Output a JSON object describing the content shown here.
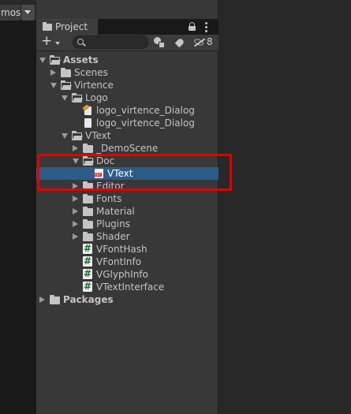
{
  "gizmos": {
    "label": "mos"
  },
  "project_panel": {
    "tab_label": "Project",
    "hidden_count": "8"
  },
  "tree": [
    {
      "label": "Assets",
      "bold": true,
      "depth": 0,
      "expand": "open",
      "icon": "folder-open-icon"
    },
    {
      "label": "Scenes",
      "depth": 1,
      "expand": "closed",
      "icon": "folder-icon"
    },
    {
      "label": "Virtence",
      "depth": 1,
      "expand": "open",
      "icon": "folder-open-icon"
    },
    {
      "label": "Logo",
      "depth": 2,
      "expand": "open",
      "icon": "folder-open-icon"
    },
    {
      "label": "logo_virtence_Dialog",
      "depth": 3,
      "expand": "none",
      "icon": "image-asset-icon"
    },
    {
      "label": "logo_virtence_Dialog",
      "depth": 3,
      "expand": "none",
      "icon": "file-icon"
    },
    {
      "label": "VText",
      "depth": 2,
      "expand": "open",
      "icon": "folder-open-icon"
    },
    {
      "label": "_DemoScene",
      "depth": 3,
      "expand": "closed",
      "icon": "folder-icon"
    },
    {
      "label": "Doc",
      "depth": 3,
      "expand": "open",
      "icon": "folder-open-icon"
    },
    {
      "label": "VText",
      "depth": 4,
      "expand": "none",
      "icon": "pdf-icon",
      "selected": true
    },
    {
      "label": "Editor",
      "depth": 3,
      "expand": "closed",
      "icon": "folder-icon"
    },
    {
      "label": "Fonts",
      "depth": 3,
      "expand": "closed",
      "icon": "folder-icon"
    },
    {
      "label": "Material",
      "depth": 3,
      "expand": "closed",
      "icon": "folder-icon"
    },
    {
      "label": "Plugins",
      "depth": 3,
      "expand": "closed",
      "icon": "folder-icon"
    },
    {
      "label": "Shader",
      "depth": 3,
      "expand": "closed",
      "icon": "folder-icon"
    },
    {
      "label": "VFontHash",
      "depth": 3,
      "expand": "none",
      "icon": "csharp-script-icon"
    },
    {
      "label": "VFontInfo",
      "depth": 3,
      "expand": "none",
      "icon": "csharp-script-icon"
    },
    {
      "label": "VGlyphInfo",
      "depth": 3,
      "expand": "none",
      "icon": "csharp-script-icon"
    },
    {
      "label": "VTextInterface",
      "depth": 3,
      "expand": "none",
      "icon": "csharp-script-icon"
    },
    {
      "label": "Packages",
      "bold": true,
      "depth": 0,
      "expand": "closed",
      "icon": "folder-icon"
    }
  ],
  "colors": {
    "selection": "#2c5d87",
    "annotation_box": "#e00000",
    "panel_bg": "#383838"
  }
}
